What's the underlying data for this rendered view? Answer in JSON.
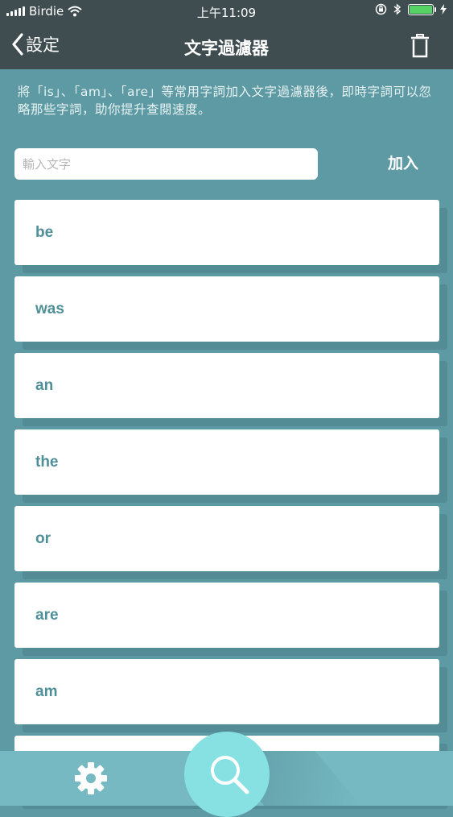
{
  "status": {
    "carrier": "Birdie",
    "time": "上午11:09",
    "battery_level": 1.0,
    "battery_color": "#56d163"
  },
  "nav": {
    "back_label": "設定",
    "title": "文字過濾器",
    "back_icon": "chevron-left-icon",
    "trash_icon": "trash-icon"
  },
  "description": "將「is」、「am」、「are」等常用字詞加入文字過濾器後，即時字詞可以忽略那些字詞，助你提升查閱速度。",
  "input": {
    "placeholder": "輸入文字",
    "value": ""
  },
  "add_label": "加入",
  "words": [
    "be",
    "was",
    "an",
    "the",
    "or",
    "are",
    "am",
    ""
  ],
  "tabbar": {
    "settings_icon": "gear-icon",
    "search_icon": "search-icon"
  },
  "colors": {
    "nav_bg": "#3f4d51",
    "page_bg": "#5e9aa3",
    "word_text": "#4f8f98",
    "tab_bg": "#76b9c2",
    "search_fab": "#87e0e2"
  }
}
